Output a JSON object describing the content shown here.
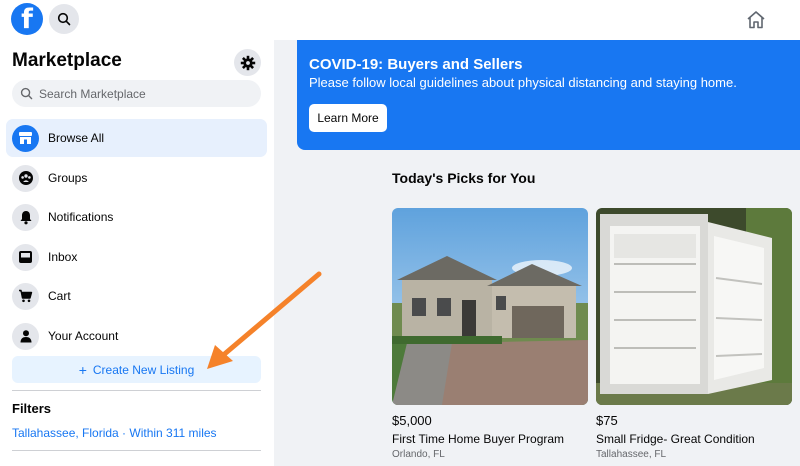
{
  "topbar": {
    "logo_letter": "f",
    "icons": {
      "search": "search-icon",
      "home": "home-icon"
    }
  },
  "sidebar": {
    "title": "Marketplace",
    "search_placeholder": "Search Marketplace",
    "nav": [
      {
        "label": "Browse All",
        "icon": "storefront-icon",
        "active": true
      },
      {
        "label": "Groups",
        "icon": "groups-icon"
      },
      {
        "label": "Notifications",
        "icon": "bell-icon"
      },
      {
        "label": "Inbox",
        "icon": "inbox-icon"
      },
      {
        "label": "Cart",
        "icon": "cart-icon"
      },
      {
        "label": "Your Account",
        "icon": "person-icon"
      }
    ],
    "create_button": "Create New Listing",
    "filters_title": "Filters",
    "filters_location": "Tallahassee, Florida · Within 311 miles"
  },
  "banner": {
    "title": "COVID-19: Buyers and Sellers",
    "text": "Please follow local guidelines about physical distancing and staying home.",
    "button": "Learn More"
  },
  "picks": {
    "title": "Today's Picks for You",
    "items": [
      {
        "price": "$5,000",
        "title": "First Time Home Buyer Program",
        "location": "Orlando, FL"
      },
      {
        "price": "$75",
        "title": "Small Fridge- Great Condition",
        "location": "Tallahassee, FL"
      }
    ]
  },
  "colors": {
    "accent": "#1877f2",
    "background": "#f0f2f5",
    "annotation_arrow": "#f5822a"
  }
}
